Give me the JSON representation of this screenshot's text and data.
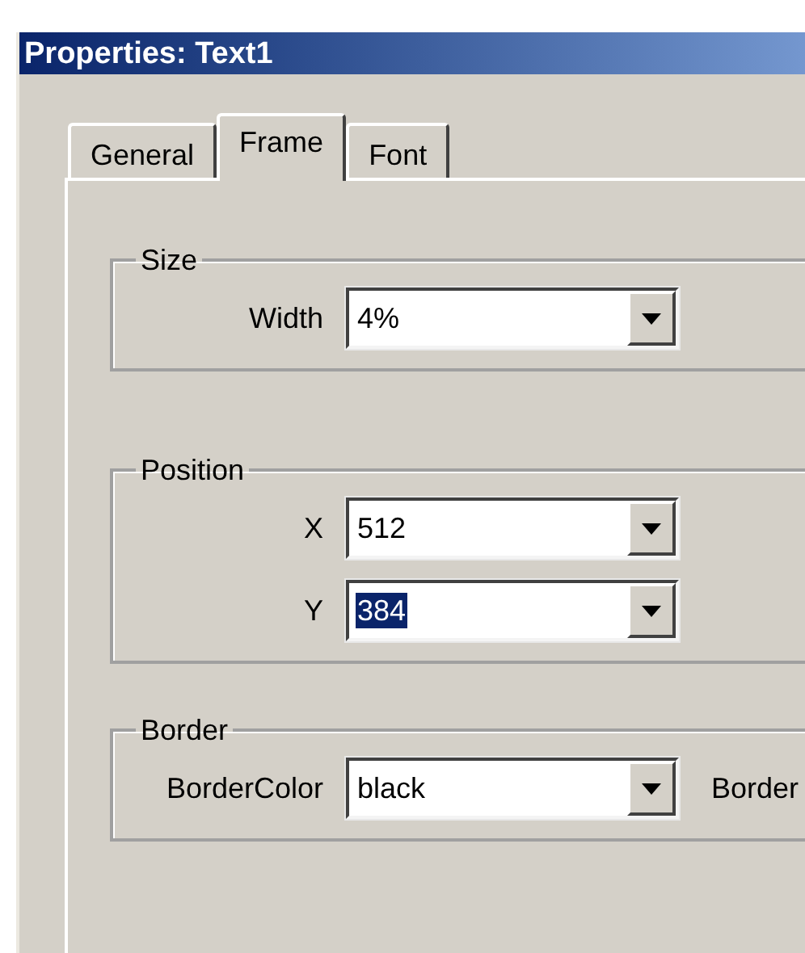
{
  "window": {
    "title": "Properties: Text1"
  },
  "tabs": [
    {
      "label": "General",
      "selected": false
    },
    {
      "label": "Frame",
      "selected": true
    },
    {
      "label": "Font",
      "selected": false
    }
  ],
  "groups": [
    {
      "title": "Size",
      "fields": [
        {
          "label": "Width",
          "value": "4%",
          "value_selected": false
        }
      ]
    },
    {
      "title": "Position",
      "fields": [
        {
          "label": "X",
          "value": "512",
          "value_selected": false
        },
        {
          "label": "Y",
          "value": "384",
          "value_selected": true
        }
      ]
    },
    {
      "title": "Border",
      "fields": [
        {
          "label": "BorderColor",
          "value": "black",
          "value_selected": false,
          "side_label": "Border"
        }
      ]
    }
  ]
}
